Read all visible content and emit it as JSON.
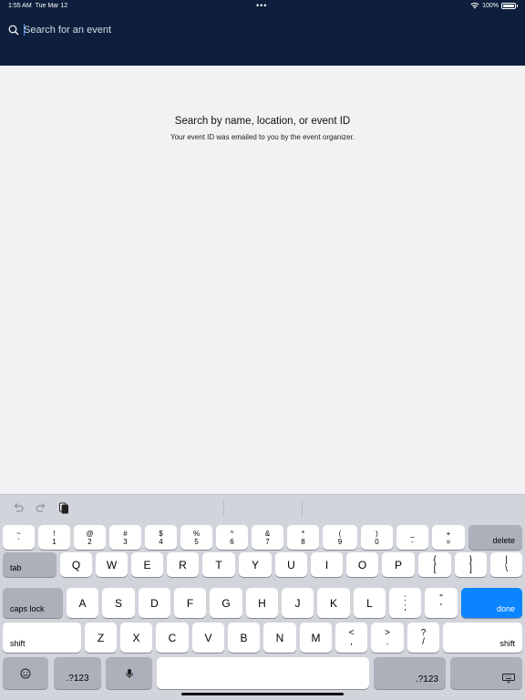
{
  "status_bar": {
    "time": "1:55 AM",
    "date": "Tue Mar 12",
    "battery": "100%"
  },
  "search": {
    "placeholder": "Search for an event",
    "value": ""
  },
  "hint": {
    "title": "Search by name, location, or event ID",
    "subtitle": "Your event ID was emailed to you by the event organizer."
  },
  "keyboard": {
    "number_row": [
      {
        "top": "~",
        "bottom": "`"
      },
      {
        "top": "!",
        "bottom": "1"
      },
      {
        "top": "@",
        "bottom": "2"
      },
      {
        "top": "#",
        "bottom": "3"
      },
      {
        "top": "$",
        "bottom": "4"
      },
      {
        "top": "%",
        "bottom": "5"
      },
      {
        "top": "^",
        "bottom": "6"
      },
      {
        "top": "&",
        "bottom": "7"
      },
      {
        "top": "*",
        "bottom": "8"
      },
      {
        "top": "(",
        "bottom": "9"
      },
      {
        "top": ")",
        "bottom": "0"
      },
      {
        "top": "_",
        "bottom": "-"
      },
      {
        "top": "+",
        "bottom": "="
      }
    ],
    "delete": "delete",
    "tab": "tab",
    "row_q": [
      "Q",
      "W",
      "E",
      "R",
      "T",
      "Y",
      "U",
      "I",
      "O",
      "P"
    ],
    "bracket_open": {
      "top": "{",
      "bottom": "["
    },
    "bracket_close": {
      "top": "}",
      "bottom": "]"
    },
    "pipe": {
      "top": "|",
      "bottom": "\\"
    },
    "caps_lock": "caps lock",
    "row_a": [
      "A",
      "S",
      "D",
      "F",
      "G",
      "H",
      "J",
      "K",
      "L"
    ],
    "semicolon": {
      "top": ":",
      "bottom": ";"
    },
    "quote": {
      "top": "\"",
      "bottom": "'"
    },
    "done": "done",
    "shift": "shift",
    "row_z": [
      "Z",
      "X",
      "C",
      "V",
      "B",
      "N",
      "M"
    ],
    "comma": {
      "top": "<",
      "bottom": ","
    },
    "period": {
      "top": ">",
      "bottom": "."
    },
    "slash": {
      "top": "?",
      "bottom": "/"
    },
    "numbers_mode": ".?123"
  },
  "colors": {
    "header": "#0d1f3c",
    "done_key": "#0a84ff"
  }
}
